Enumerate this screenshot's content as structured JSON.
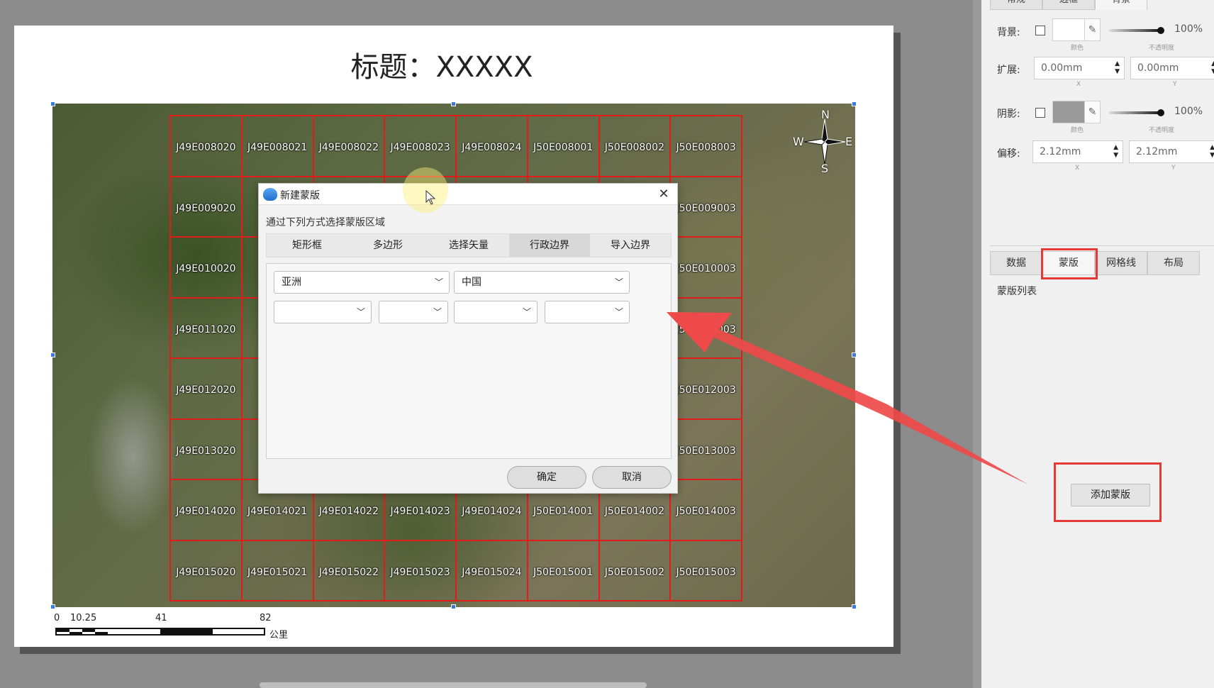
{
  "page": {
    "title": "标题：XXXXX"
  },
  "map": {
    "grid_labels": [
      [
        "J49E008020",
        "J49E008021",
        "J49E008022",
        "J49E008023",
        "J49E008024",
        "J50E008001",
        "J50E008002",
        "J50E008003"
      ],
      [
        "J49E009020",
        "",
        "",
        "",
        "",
        "",
        "",
        "J50E009003"
      ],
      [
        "J49E010020",
        "",
        "",
        "",
        "",
        "",
        "",
        "J50E010003"
      ],
      [
        "J49E011020",
        "",
        "",
        "",
        "",
        "",
        "",
        "J50E011003"
      ],
      [
        "J49E012020",
        "",
        "",
        "",
        "",
        "",
        "",
        "J50E012003"
      ],
      [
        "J49E013020",
        "",
        "",
        "",
        "",
        "",
        "",
        "J50E013003"
      ],
      [
        "J49E014020",
        "J49E014021",
        "J49E014022",
        "J49E014023",
        "J49E014024",
        "J50E014001",
        "J50E014002",
        "J50E014003"
      ],
      [
        "J49E015020",
        "J49E015021",
        "J49E015022",
        "J49E015023",
        "J49E015024",
        "J50E015001",
        "J50E015002",
        "J50E015003"
      ]
    ],
    "compass": {
      "n": "N",
      "s": "S",
      "e": "E",
      "w": "W"
    },
    "scale": {
      "ticks": [
        "0",
        "10.25",
        "41",
        "82"
      ],
      "unit": "公里"
    }
  },
  "dialog": {
    "title": "新建蒙版",
    "hint": "通过下列方式选择蒙版区域",
    "tabs": [
      "矩形框",
      "多边形",
      "选择矢量",
      "行政边界",
      "导入边界"
    ],
    "active_tab": "行政边界",
    "select_continent": "亚洲",
    "select_country": "中国",
    "select_province": "",
    "select_city": "",
    "select_county": "",
    "select_town": "",
    "ok_label": "确定",
    "cancel_label": "取消"
  },
  "panel": {
    "top_tabs": [
      "常规",
      "边框",
      "背景"
    ],
    "active_top_tab": "背景",
    "background": {
      "label": "背景:",
      "color_sub": "颜色",
      "opacity": "100%",
      "opacity_sub": "不透明度"
    },
    "expand": {
      "label": "扩展:",
      "x": "0.00mm",
      "y": "0.00mm",
      "x_sub": "X",
      "y_sub": "Y"
    },
    "shadow": {
      "label": "阴影:",
      "color_sub": "颜色",
      "opacity": "100%",
      "opacity_sub": "不透明度",
      "color": "#9a9a9a"
    },
    "offset": {
      "label": "偏移:",
      "x": "2.12mm",
      "y": "2.12mm",
      "x_sub": "X",
      "y_sub": "Y"
    },
    "bottom_tabs": [
      "数据",
      "蒙版",
      "网格线",
      "布局"
    ],
    "active_bottom_tab": "蒙版",
    "mask_list_label": "蒙版列表",
    "add_mask_label": "添加蒙版"
  },
  "colors": {
    "grid_line": "#e21b1b",
    "annotation_red": "#e53935",
    "dialog_accent": "#1f6fd0"
  }
}
